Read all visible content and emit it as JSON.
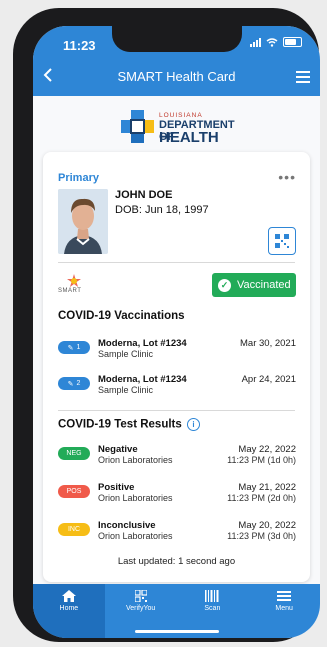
{
  "status": {
    "time": "11:23"
  },
  "header": {
    "title": "SMART Health Card"
  },
  "logo": {
    "state": "LOUISIANA",
    "line1": "DEPARTMENT OF",
    "line2": "HEALTH"
  },
  "card": {
    "label": "Primary",
    "name": "JOHN DOE",
    "dob": "DOB: Jun 18, 1997",
    "issuer_mark": "SMART",
    "status_badge": "Vaccinated",
    "vaccinations": {
      "title": "COVID-19 Vaccinations",
      "items": [
        {
          "dose": "1",
          "title": "Moderna, Lot #1234",
          "location": "Sample Clinic",
          "date": "Mar 30, 2021"
        },
        {
          "dose": "2",
          "title": "Moderna, Lot #1234",
          "location": "Sample Clinic",
          "date": "Apr 24, 2021"
        }
      ]
    },
    "tests": {
      "title": "COVID-19 Test Results",
      "items": [
        {
          "code": "NEG",
          "color": "#22ab58",
          "result": "Negative",
          "lab": "Orion Laboratories",
          "date": "May 22, 2022",
          "time": "11:23 PM (1d 0h)"
        },
        {
          "code": "POS",
          "color": "#f05a4a",
          "result": "Positive",
          "lab": "Orion Laboratories",
          "date": "May 21, 2022",
          "time": "11:23 PM (2d 0h)"
        },
        {
          "code": "INC",
          "color": "#f6bd16",
          "result": "Inconclusive",
          "lab": "Orion Laboratories",
          "date": "May 20, 2022",
          "time": "11:23 PM (3d 0h)"
        }
      ]
    },
    "last_updated": "Last updated: 1 second ago"
  },
  "tabs": [
    {
      "label": "Home",
      "icon": "home-icon"
    },
    {
      "label": "VerifyYou",
      "icon": "qr-code-icon"
    },
    {
      "label": "Scan",
      "icon": "barcode-icon"
    },
    {
      "label": "Menu",
      "icon": "menu-icon"
    }
  ],
  "colors": {
    "brand_blue": "#2e86d6",
    "success": "#22ab58",
    "danger": "#f05a4a",
    "warning": "#f6bd16"
  }
}
